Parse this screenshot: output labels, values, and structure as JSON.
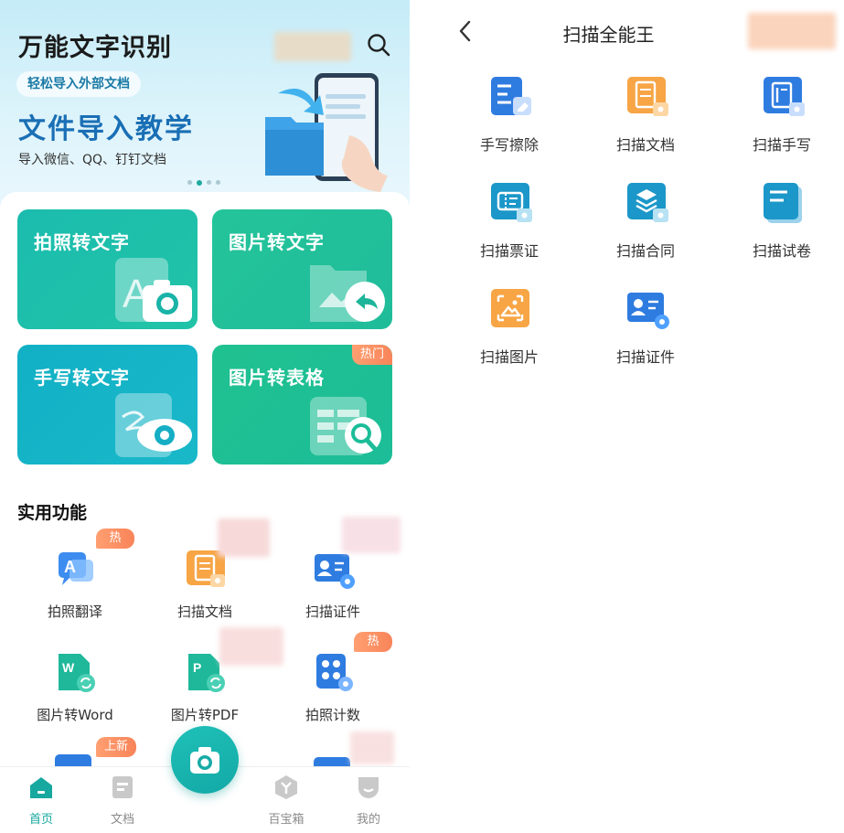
{
  "home": {
    "app_title": "万能文字识别",
    "banner": {
      "pill": "轻松导入外部文档",
      "headline": "文件导入教学",
      "subline": "导入微信、QQ、钉钉文档"
    },
    "cards": [
      {
        "label": "拍照转文字",
        "icon": "camera-text-icon"
      },
      {
        "label": "图片转文字",
        "icon": "image-folder-icon"
      },
      {
        "label": "手写转文字",
        "icon": "handwriting-eye-icon"
      },
      {
        "label": "图片转表格",
        "icon": "table-search-icon",
        "badge": "热门"
      }
    ],
    "section_title": "实用功能",
    "tools": [
      {
        "label": "拍照翻译",
        "icon": "translate-icon",
        "badge": "热门"
      },
      {
        "label": "扫描文档",
        "icon": "scan-document-icon"
      },
      {
        "label": "扫描证件",
        "icon": "id-card-icon"
      },
      {
        "label": "图片转Word",
        "icon": "word-icon"
      },
      {
        "label": "图片转PDF",
        "icon": "pdf-icon"
      },
      {
        "label": "拍照计数",
        "icon": "count-icon",
        "badge": "热门"
      }
    ],
    "partial_badge": "上新",
    "tabs": [
      {
        "label": "首页",
        "icon": "home-icon",
        "active": true
      },
      {
        "label": "文档",
        "icon": "document-icon"
      },
      {
        "label": "百宝箱",
        "icon": "toolbox-icon"
      },
      {
        "label": "我的",
        "icon": "profile-icon"
      }
    ]
  },
  "scanner": {
    "title": "扫描全能王",
    "tools": [
      {
        "label": "手写擦除",
        "icon": "handwriting-erase-icon"
      },
      {
        "label": "扫描文档",
        "icon": "scan-document-icon"
      },
      {
        "label": "扫描手写",
        "icon": "scan-handwriting-icon"
      },
      {
        "label": "扫描票证",
        "icon": "scan-ticket-icon"
      },
      {
        "label": "扫描合同",
        "icon": "scan-contract-icon"
      },
      {
        "label": "扫描试卷",
        "icon": "scan-exam-icon"
      },
      {
        "label": "扫描图片",
        "icon": "scan-image-icon"
      },
      {
        "label": "扫描证件",
        "icon": "id-card-icon"
      }
    ]
  },
  "colors": {
    "accent": "#17a89f",
    "banner_head": "#1a6fb5",
    "hot_badge": "#f88459",
    "icon_blue": "#2f7ce0",
    "icon_orange": "#f49a35"
  }
}
